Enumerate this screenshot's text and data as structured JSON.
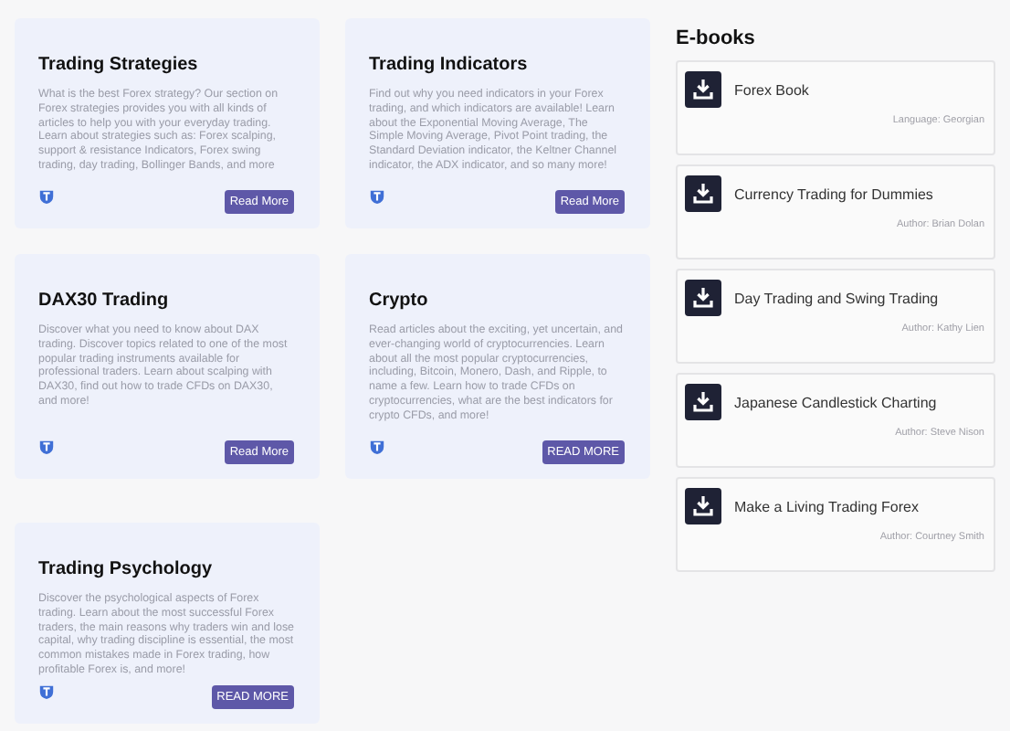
{
  "articles": [
    {
      "title": "Trading Strategies",
      "body": "What is the best Forex strategy? Our section on Forex strategies provides you with all kinds of articles to help you with your everyday trading. Learn about strategies such as: Forex scalping, support & resistance Indicators, Forex swing trading, day trading, Bollinger Bands, and more",
      "button": "Read More"
    },
    {
      "title": "Trading Indicators",
      "body": "Find out why you need indicators in your Forex trading, and which indicators are available! Learn about the Exponential Moving Average, The Simple Moving Average, Pivot Point trading, the Standard Deviation indicator, the Keltner Channel indicator, the ADX indicator, and so many more!",
      "button": "Read More"
    },
    {
      "title": "DAX30 Trading",
      "body": "Discover what you need to know about DAX trading. Discover topics related to one of the most popular trading instruments available for professional traders. Learn about scalping with DAX30, find out how to trade CFDs on DAX30, and more!",
      "button": "Read More"
    },
    {
      "title": "Crypto",
      "body": "Read articles about the exciting, yet uncertain, and ever-changing world of cryptocurrencies. Learn about all the most popular cryptocurrencies, including, Bitcoin, Monero, Dash, and Ripple, to name a few. Learn how to trade CFDs on cryptocurrencies, what are the best indicators for crypto CFDs, and more!",
      "button": "READ MORE"
    },
    {
      "title": "Trading Psychology",
      "body": "Discover the psychological aspects of Forex trading. Learn about the most successful Forex traders, the main reasons why traders win and lose capital, why trading discipline is essential, the most common mistakes made in Forex trading, how profitable Forex is, and more!",
      "button": "READ MORE"
    }
  ],
  "ebooks": {
    "title": "E-books",
    "items": [
      {
        "title": "Forex Book",
        "meta": "Language: Georgian"
      },
      {
        "title": "Currency Trading for Dummies",
        "meta": "Author: Brian Dolan"
      },
      {
        "title": "Day Trading and Swing Trading",
        "meta": "Author: Kathy Lien"
      },
      {
        "title": "Japanese Candlestick Charting",
        "meta": "Author: Steve Nison"
      },
      {
        "title": "Make a Living Trading Forex",
        "meta": "Author: Courtney Smith"
      }
    ]
  }
}
